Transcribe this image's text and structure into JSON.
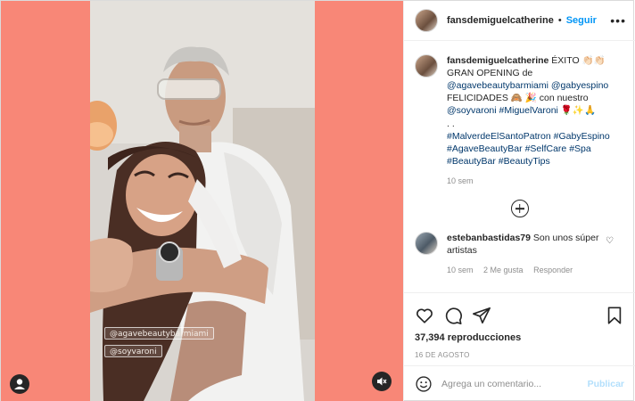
{
  "post": {
    "username": "fansdemiguelcatherine",
    "separator": "•",
    "follow_label": "Seguir",
    "more_label": "•••"
  },
  "caption": {
    "username": "fansdemiguelcatherine",
    "text_1": "ÉXITO 👏🏻👏🏻 GRAN OPENING de",
    "mention_1": "@agavebeautybarmiami",
    "mention_2": "@gabyespino",
    "text_2": "FELICIDADES 🙈 🎉 con nuestro",
    "mention_3": "@soyvaroni",
    "hashtag_1": "#MiguelVaroni",
    "text_3": "🌹✨🙏",
    "dots": ". .",
    "hashtags": [
      "#MalverdeElSantoPatron",
      "#GabyEspino",
      "#AgaveBeautyBar",
      "#SelfCare",
      "#Spa",
      "#BeautyBar",
      "#BeautyTips"
    ],
    "age": "10 sem"
  },
  "comment": {
    "username": "estebanbastidas79",
    "text": "Son unos súper artistas",
    "age": "10 sem",
    "likes": "2 Me gusta",
    "reply": "Responder"
  },
  "video": {
    "sticker_1": "@agavebeautybarmiami",
    "sticker_2": "@soyvaroni"
  },
  "stats": {
    "views": "37,394 reproducciones",
    "date": "16 DE AGOSTO"
  },
  "add_comment": {
    "placeholder": "Agrega un comentario...",
    "publish_label": "Publicar"
  },
  "icons": {
    "like": "heart-icon",
    "comment": "comment-icon",
    "share": "share-icon",
    "save": "bookmark-icon",
    "emoji": "emoji-icon",
    "mute": "muted-speaker-icon",
    "user": "user-tag-icon",
    "load_more": "plus-circle-icon"
  },
  "colors": {
    "media_bg": "#f88777",
    "link": "#00376b",
    "follow": "#0095f6",
    "muted_text": "#8e8e8e",
    "publish_disabled": "#b2dffc"
  }
}
